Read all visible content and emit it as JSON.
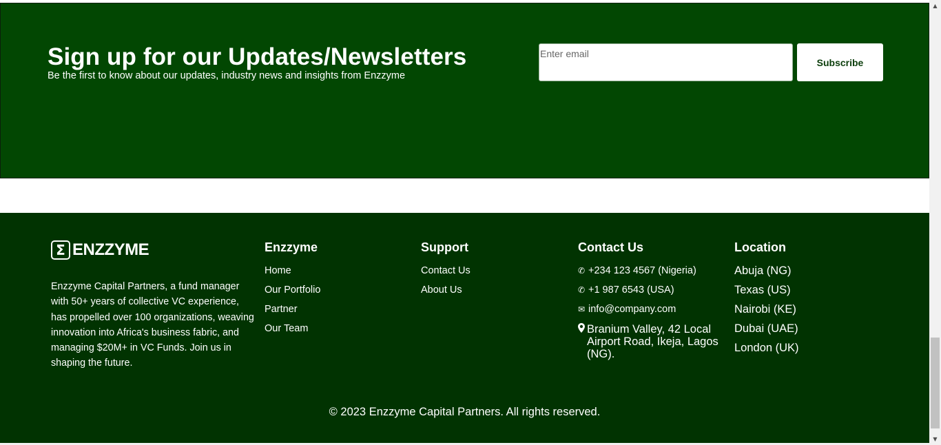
{
  "newsletter": {
    "title": "Sign up for our Updates/Newsletters",
    "subtitle": "Be the first to know about our updates, industry news and insights from Enzzyme",
    "email_placeholder": "Enter email",
    "subscribe_label": "Subscribe",
    "background_color": "#024702"
  },
  "footer": {
    "background_color": "#013301",
    "brand": {
      "mark": "Σ",
      "name": "ENZZYME"
    },
    "about": "Enzzyme Capital Partners, a fund manager with 50+ years of collective VC experience, has propelled over 100 organizations, weaving innovation into Africa's business fabric, and managing $20M+ in VC Funds. Join us in shaping the future.",
    "enzzyme": {
      "heading": "Enzzyme",
      "links": [
        "Home",
        "Our Portfolio",
        "Partner",
        "Our Team"
      ]
    },
    "support": {
      "heading": "Support",
      "links": [
        "Contact Us",
        "About Us"
      ]
    },
    "contact": {
      "heading": "Contact Us",
      "phone_ng": "+234 123 4567 (Nigeria)",
      "phone_us": "+1 987 6543 (USA)",
      "email": "info@company.com",
      "address": "Branium Valley, 42 Local Airport Road, Ikeja, Lagos (NG).",
      "icons": [
        "phone-icon",
        "phone-icon",
        "envelope-icon",
        "map-marker-icon"
      ]
    },
    "location": {
      "heading": "Location",
      "items": [
        "Abuja (NG)",
        "Texas (US)",
        "Nairobi (KE)",
        "Dubai (UAE)",
        "London (UK)"
      ]
    },
    "copyright": "© 2023 Enzzyme Capital Partners. All rights reserved."
  }
}
